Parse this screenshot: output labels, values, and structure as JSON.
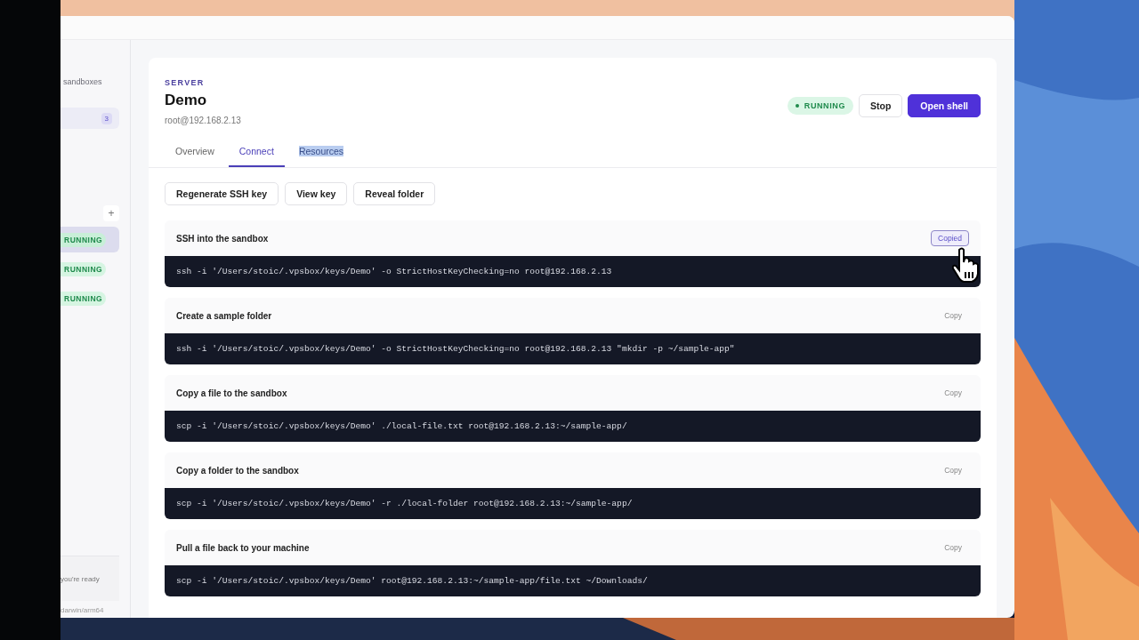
{
  "sidebar": {
    "caption": "sandboxes",
    "group_count": "3",
    "add_button": "+",
    "statuses": [
      {
        "label": "RUNNING",
        "selected": true
      },
      {
        "label": "RUNNING",
        "selected": false
      },
      {
        "label": "RUNNING",
        "selected": false
      }
    ],
    "note": "you're ready",
    "platform": "darwin/arm64"
  },
  "server": {
    "eyebrow": "SERVER",
    "name": "Demo",
    "address": "root@192.168.2.13",
    "status": "RUNNING",
    "stop_button": "Stop",
    "open_button": "Open shell"
  },
  "tabs": [
    {
      "label": "Overview",
      "selected": false,
      "highlighted": false
    },
    {
      "label": "Connect",
      "selected": true,
      "highlighted": false
    },
    {
      "label": "Resources",
      "selected": false,
      "highlighted": true
    }
  ],
  "actions": [
    "Regenerate SSH key",
    "View key",
    "Reveal folder"
  ],
  "commands": [
    {
      "title": "SSH into the sandbox",
      "button": "Copied",
      "copied": true,
      "command": "ssh -i '/Users/stoic/.vpsbox/keys/Demo' -o StrictHostKeyChecking=no root@192.168.2.13"
    },
    {
      "title": "Create a sample folder",
      "button": "Copy",
      "copied": false,
      "command": "ssh -i '/Users/stoic/.vpsbox/keys/Demo' -o StrictHostKeyChecking=no root@192.168.2.13 \"mkdir -p ~/sample-app\""
    },
    {
      "title": "Copy a file to the sandbox",
      "button": "Copy",
      "copied": false,
      "command": "scp -i '/Users/stoic/.vpsbox/keys/Demo' ./local-file.txt root@192.168.2.13:~/sample-app/"
    },
    {
      "title": "Copy a folder to the sandbox",
      "button": "Copy",
      "copied": false,
      "command": "scp -i '/Users/stoic/.vpsbox/keys/Demo' -r ./local-folder root@192.168.2.13:~/sample-app/"
    },
    {
      "title": "Pull a file back to your machine",
      "button": "Copy",
      "copied": false,
      "command": "scp -i '/Users/stoic/.vpsbox/keys/Demo' root@192.168.2.13:~/sample-app/file.txt ~/Downloads/"
    }
  ]
}
